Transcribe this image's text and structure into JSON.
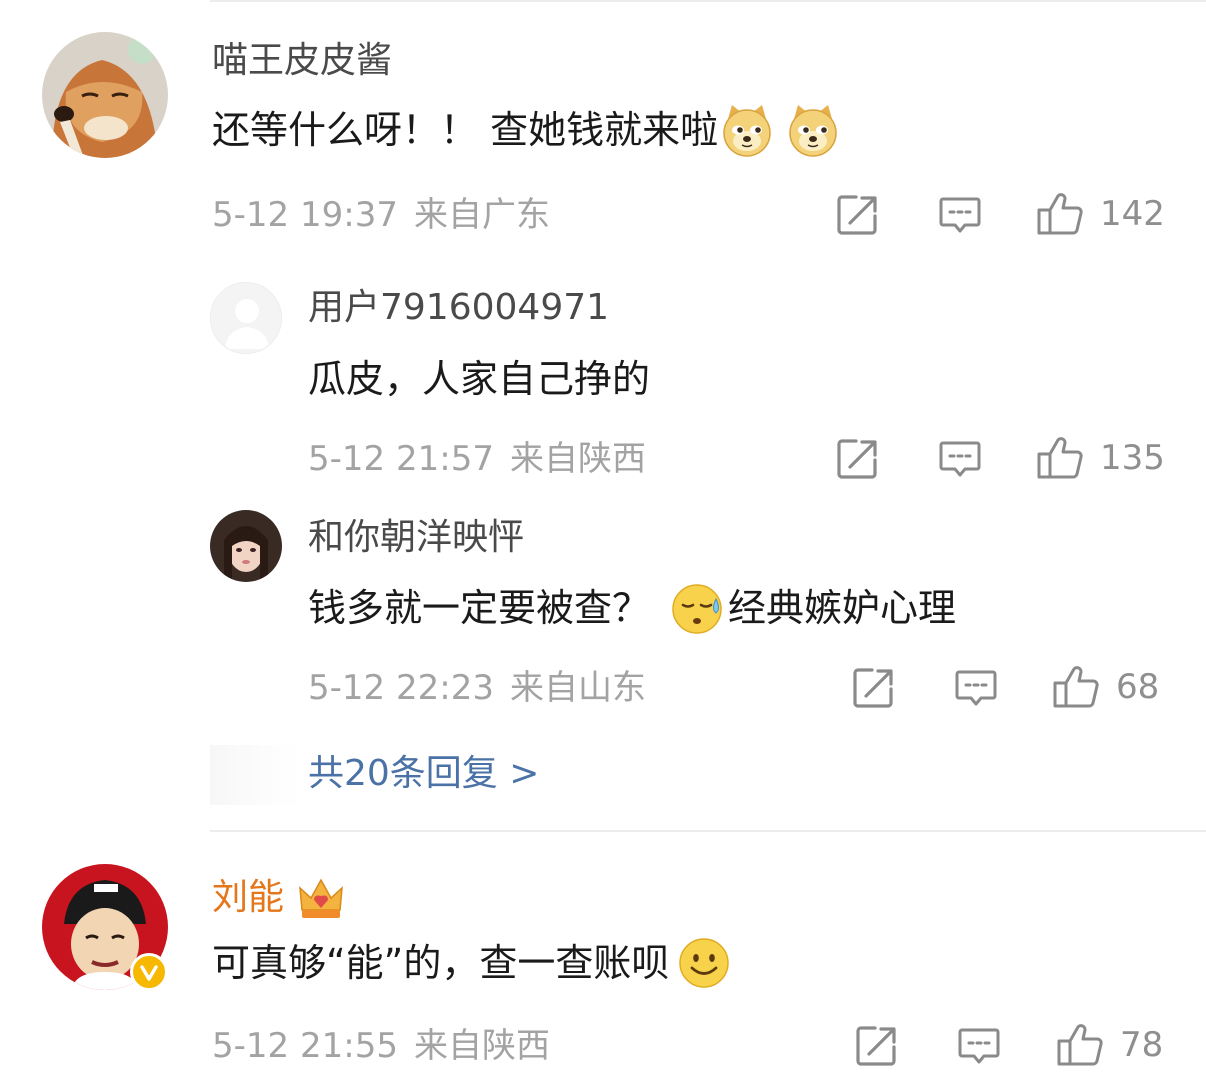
{
  "comments": [
    {
      "user": "喵王皮皮酱",
      "text": "还等什么呀！！ 查她钱就来啦",
      "emojis": [
        "doge-emoji",
        "doge-emoji"
      ],
      "date": "5-12 19:37",
      "location": "来自广东",
      "likes": "142",
      "replies": [
        {
          "user": "用户7916004971",
          "text": "瓜皮，人家自己挣的",
          "date": "5-12 21:57",
          "location": "来自陕西",
          "likes": "135"
        },
        {
          "user": "和你朝洋映怦",
          "text_before": "钱多就一定要被查？",
          "emoji": "sweat-emoji",
          "text_after": "经典嫉妒心理",
          "date": "5-12 22:23",
          "location": "来自山东",
          "likes": "68"
        }
      ],
      "more_replies": "共20条回复 >"
    },
    {
      "user": "刘能",
      "user_color": "#e5771b",
      "badge": "crown-badge-icon",
      "verified": "verified-v-icon",
      "text": "可真够“能”的，查一查账呗",
      "emoji": "smile-emoji",
      "date": "5-12 21:55",
      "location": "来自陕西",
      "likes": "78"
    }
  ],
  "icons": {
    "share": "share-icon",
    "comment": "comment-icon",
    "like": "thumbs-up-icon"
  },
  "colors": {
    "link": "#4b72a6",
    "meta": "#a3a3a3",
    "vip_name": "#e5771b"
  }
}
